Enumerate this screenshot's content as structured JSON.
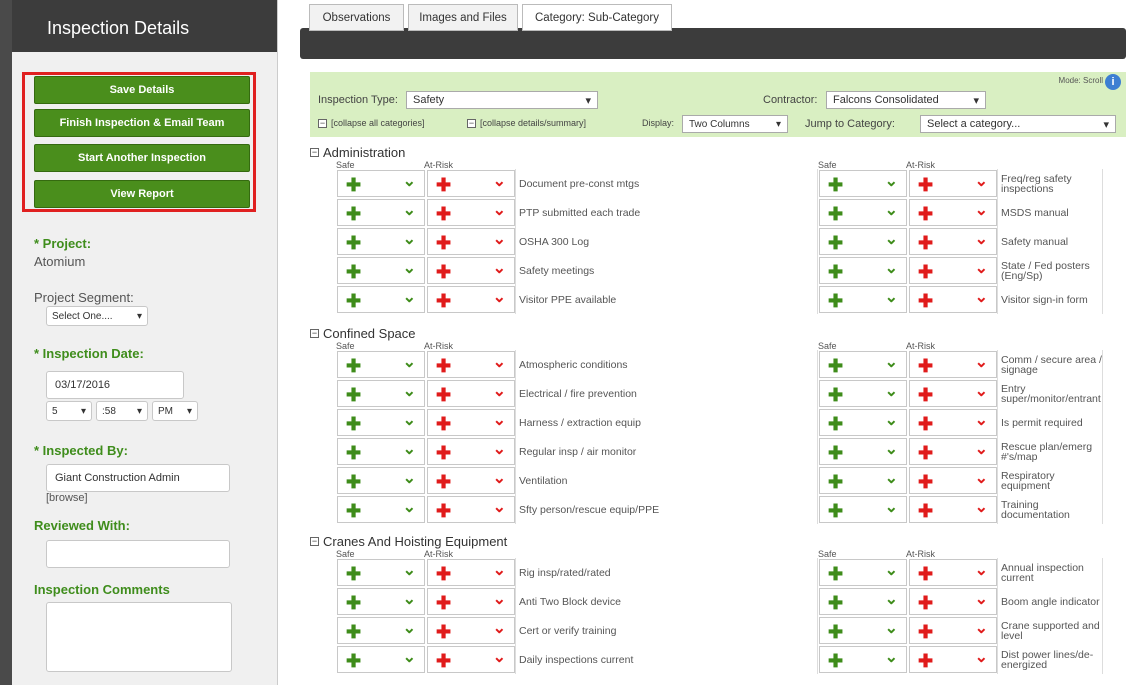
{
  "sidebar": {
    "title": "Inspection Details",
    "buttons": [
      "Save Details",
      "Finish Inspection & Email Team",
      "Start Another Inspection",
      "View Report"
    ],
    "project_label": "* Project:",
    "project_value": "Atomium",
    "segment_label": "Project Segment:",
    "segment_value": "Select One....",
    "date_label": "* Inspection Date:",
    "date_value": "03/17/2016",
    "hour": "5",
    "minute": ":58",
    "ampm": "PM",
    "inspected_by_label": "* Inspected By:",
    "inspected_by_value": "Giant Construction Admin",
    "browse": "[browse]",
    "reviewed_label": "Reviewed With:",
    "comments_label": "Inspection Comments"
  },
  "tabs": [
    "Observations",
    "Images and Files",
    "Category: Sub-Category"
  ],
  "filters": {
    "mode_label": "Mode: Scroll",
    "type_label": "Inspection Type:",
    "type_value": "Safety",
    "contractor_label": "Contractor:",
    "contractor_value": "Falcons Consolidated",
    "collapse_all": "[collapse all categories]",
    "collapse_details": "[collapse details/summary]",
    "display_label": "Display:",
    "display_value": "Two Columns",
    "jump_label": "Jump to Category:",
    "jump_value": "Select a category..."
  },
  "sub_labels": {
    "safe": "Safe",
    "risk": "At-Risk"
  },
  "icons": {
    "plus": "plus-icon",
    "check": "chevron-check-icon",
    "info": "info-icon"
  },
  "categories": [
    {
      "name": "Administration",
      "left": [
        "Document pre-const mtgs",
        "PTP submitted each trade",
        "OSHA 300 Log",
        "Safety meetings",
        "Visitor PPE available"
      ],
      "right": [
        "Freq/reg safety inspections",
        "MSDS manual",
        "Safety manual",
        "State / Fed posters (Eng/Sp)",
        "Visitor sign-in form"
      ]
    },
    {
      "name": "Confined Space",
      "left": [
        "Atmospheric conditions",
        "Electrical / fire prevention",
        "Harness / extraction equip",
        "Regular insp / air monitor",
        "Ventilation",
        "Sfty person/rescue equip/PPE"
      ],
      "right": [
        "Comm / secure area / signage",
        "Entry super/monitor/entrant",
        "Is permit required",
        "Rescue plan/emerg #'s/map",
        "Respiratory equipment",
        "Training documentation"
      ]
    },
    {
      "name": "Cranes And Hoisting Equipment",
      "left": [
        "Rig insp/rated/rated",
        "Anti Two Block device",
        "Cert or verify training",
        "Daily inspections current"
      ],
      "right": [
        "Annual inspection current",
        "Boom angle indicator",
        "Crane supported and level",
        "Dist power lines/de-energized"
      ]
    }
  ]
}
